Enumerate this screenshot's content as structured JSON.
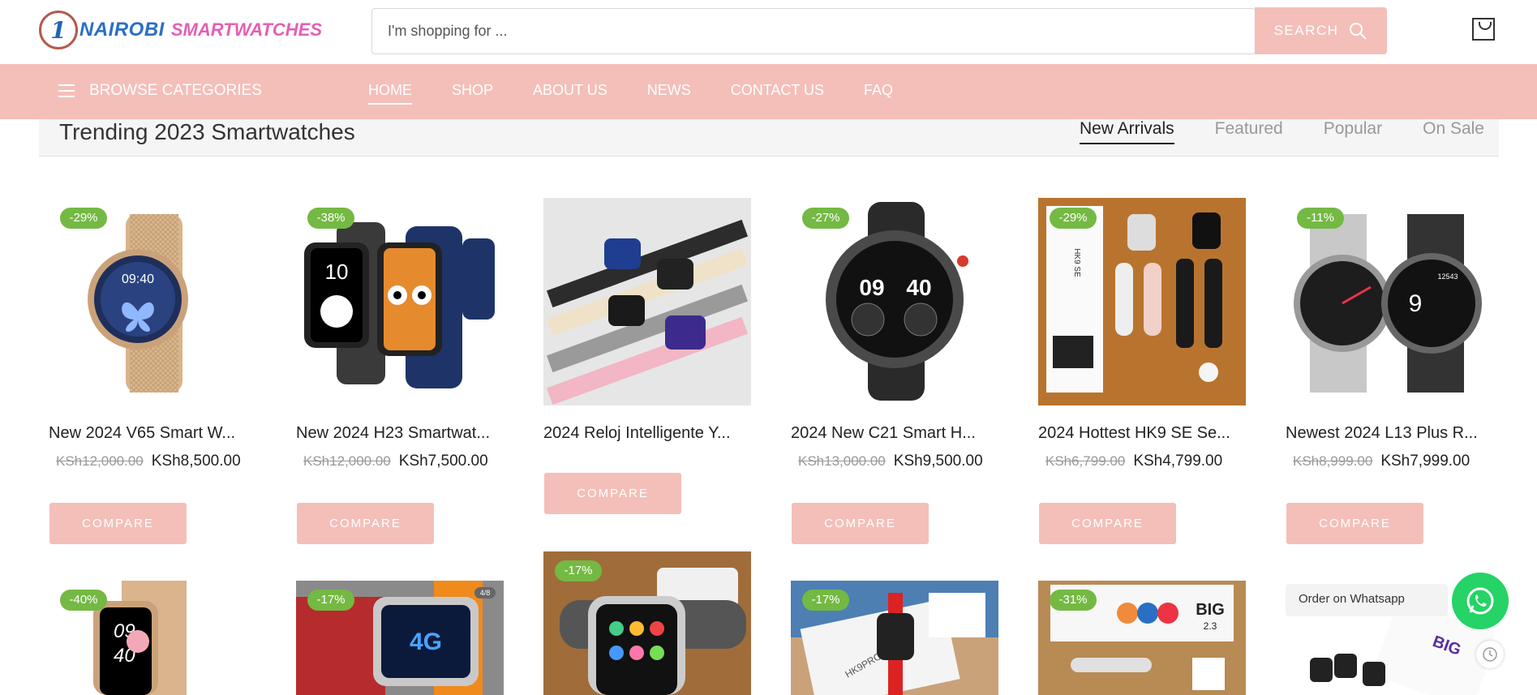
{
  "brand": {
    "mark": "1",
    "name1": "NAIROBI",
    "name2": "SMARTWATCHES"
  },
  "search": {
    "placeholder": "I'm shopping for ...",
    "button_label": "SEARCH"
  },
  "nav": {
    "browse_label": "BROWSE CATEGORIES",
    "items": [
      {
        "label": "HOME",
        "active": true
      },
      {
        "label": "SHOP"
      },
      {
        "label": "ABOUT US"
      },
      {
        "label": "NEWS"
      },
      {
        "label": "CONTACT US"
      },
      {
        "label": "FAQ"
      }
    ]
  },
  "section": {
    "title": "Trending 2023 Smartwatches",
    "tabs": [
      "New Arrivals",
      "Featured",
      "Popular",
      "On Sale"
    ]
  },
  "products": [
    {
      "title": "New 2024 V65 Smart W...",
      "badge": "-29%",
      "old_price": "KSh12,000.00",
      "price": "KSh8,500.00",
      "compare": "COMPARE"
    },
    {
      "title": "New 2024 H23 Smartwat...",
      "badge": "-38%",
      "old_price": "KSh12,000.00",
      "price": "KSh7,500.00",
      "compare": "COMPARE"
    },
    {
      "title": "2024 Reloj Intelligente Y...",
      "badge": "",
      "old_price": "",
      "price": "",
      "compare": "COMPARE"
    },
    {
      "title": "2024 New C21 Smart H...",
      "badge": "-27%",
      "old_price": "KSh13,000.00",
      "price": "KSh9,500.00",
      "compare": "COMPARE"
    },
    {
      "title": "2024 Hottest HK9 SE Se...",
      "badge": "-29%",
      "old_price": "KSh6,799.00",
      "price": "KSh4,799.00",
      "compare": "COMPARE"
    },
    {
      "title": "Newest 2024 L13 Plus R...",
      "badge": "-11%",
      "old_price": "KSh8,999.00",
      "price": "KSh7,999.00",
      "compare": "COMPARE"
    }
  ],
  "row2_badges": [
    "-40%",
    "-17%",
    "-17%",
    "-17%",
    "-31%"
  ],
  "image_texts": {
    "p1_time": "09:40",
    "p2_time": "10",
    "p4_left": "09",
    "p4_right": "40",
    "p5_box": "HK9 SE",
    "p6_left": "9",
    "p6_right": "12543",
    "r2a_time1": "09",
    "r2a_time2": "40",
    "r2b_counter": "4/8",
    "r2b_tag": "4G",
    "r2d_box": "HK9PRO+",
    "r2e_big": "BIG",
    "r2e_size": "2.3",
    "r2f_big": "BIG"
  },
  "whatsapp": {
    "label": "Order on Whatsapp"
  },
  "colors": {
    "accent": "#f4bfb9",
    "badge": "#74b943",
    "whatsapp": "#25d366"
  }
}
